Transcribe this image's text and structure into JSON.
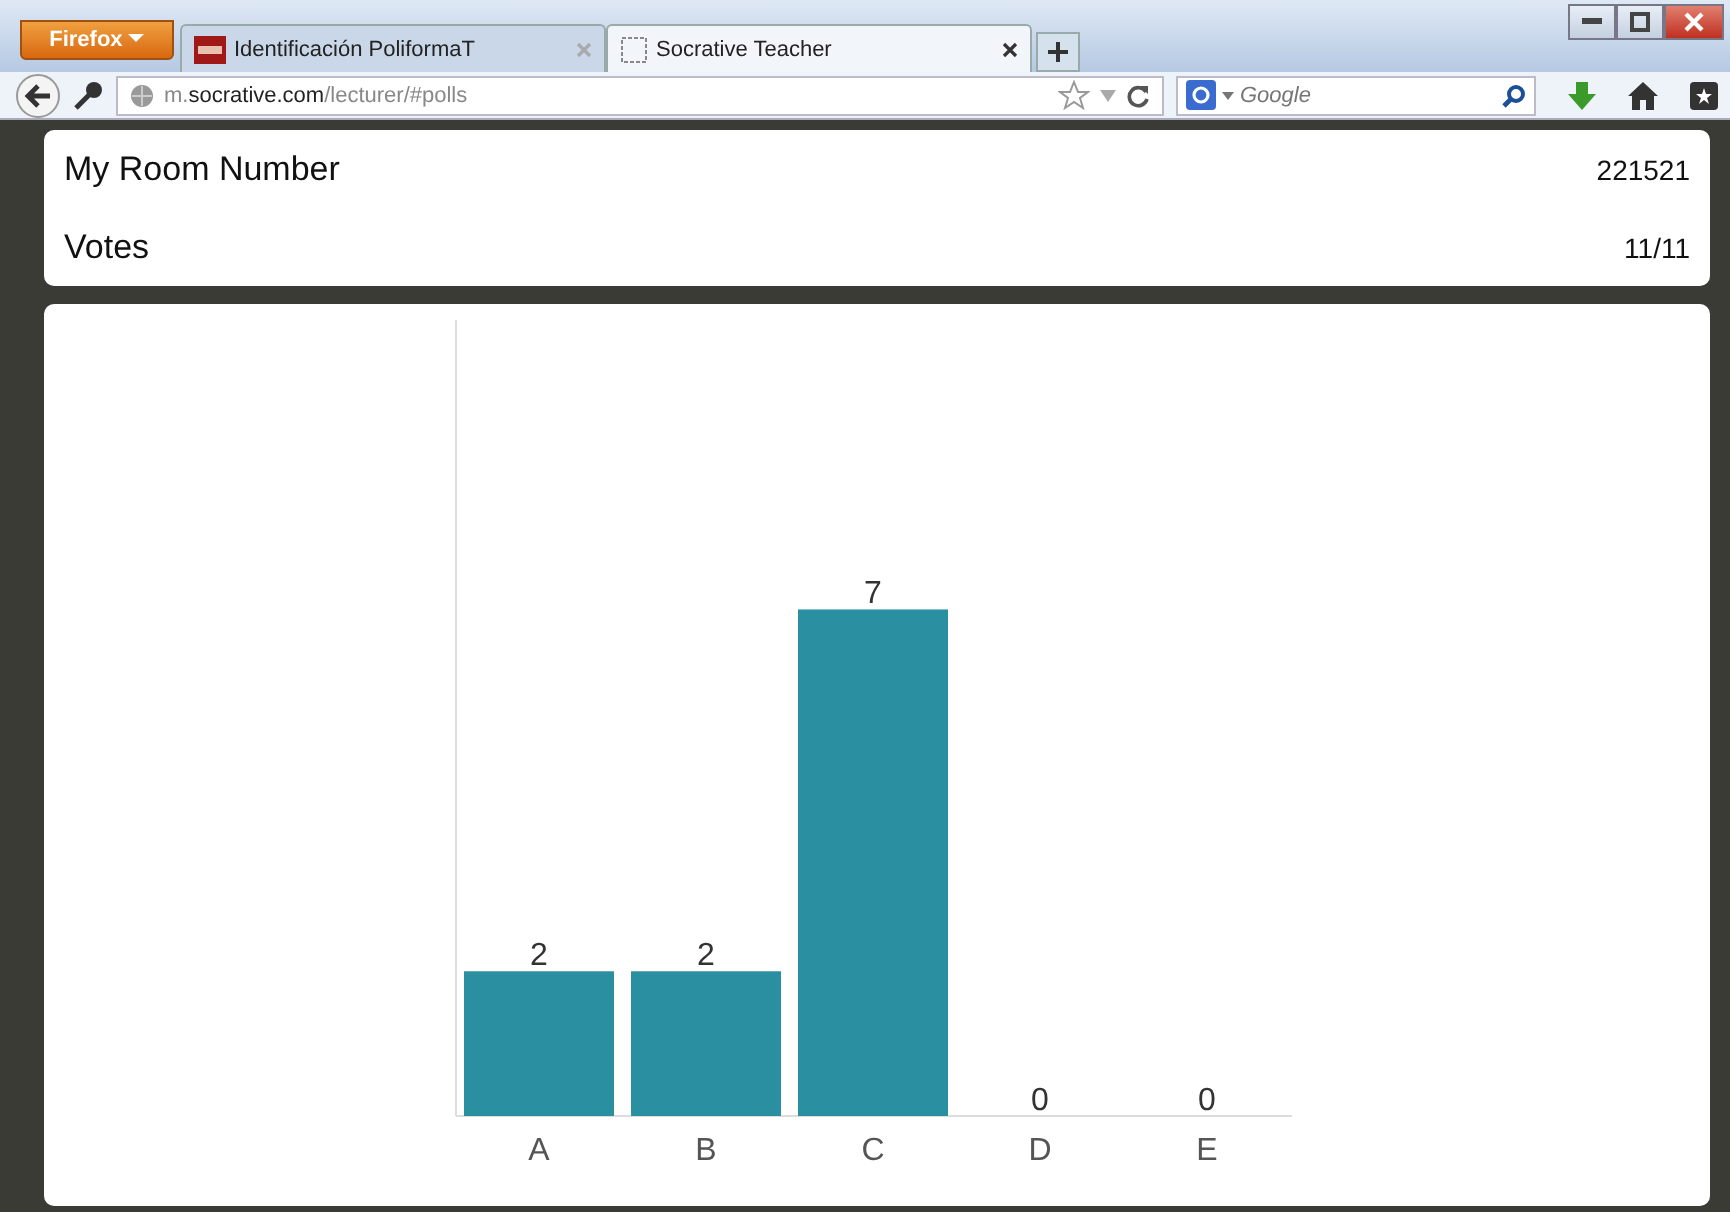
{
  "browser": {
    "menu_button": "Firefox",
    "tabs": [
      {
        "title": "Identificación PoliformaT",
        "selected": false
      },
      {
        "title": "Socrative Teacher",
        "selected": true
      }
    ],
    "url": "m.**socrative.com**/lecturer/#polls",
    "search": {
      "placeholder": "Google"
    }
  },
  "room": {
    "label": "My Room Number",
    "value": "221521"
  },
  "votes": {
    "label": "Votes",
    "value": "11/11"
  },
  "chart_data": {
    "type": "bar",
    "categories": [
      "A",
      "B",
      "C",
      "D",
      "E"
    ],
    "values": [
      2,
      2,
      7,
      0,
      0
    ],
    "data_labels": true
  }
}
